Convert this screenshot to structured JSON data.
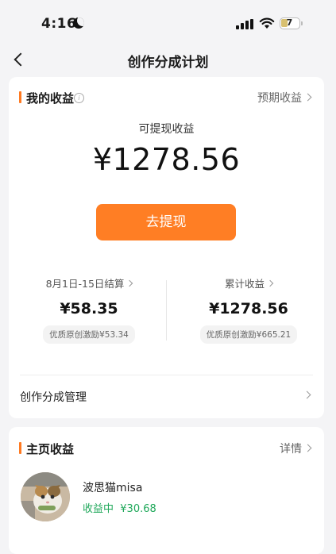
{
  "status_bar": {
    "time": "4:16",
    "battery": "7"
  },
  "nav": {
    "title": "创作分成计划"
  },
  "earnings": {
    "title": "我的收益",
    "expected_link": "预期收益",
    "withdrawable_label": "可提现收益",
    "withdrawable_amount": "¥1278.56",
    "withdraw_button": "去提现",
    "period": {
      "label": "8月1日-15日结算",
      "value": "¥58.35",
      "incentive": "优质原创激励¥53.34"
    },
    "cumulative": {
      "label": "累计收益",
      "value": "¥1278.56",
      "incentive": "优质原创激励¥665.21"
    },
    "management_label": "创作分成管理"
  },
  "home_earnings": {
    "title": "主页收益",
    "details_link": "详情",
    "user": {
      "name": "波思猫misa",
      "status": "收益中",
      "amount": "¥30.68"
    }
  },
  "colors": {
    "accent": "#ff7e24",
    "positive": "#1fa85a"
  }
}
